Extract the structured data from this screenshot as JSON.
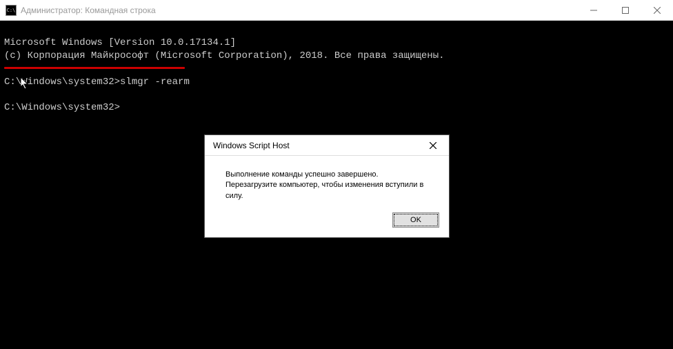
{
  "window": {
    "title": "Администратор: Командная строка",
    "icon_label": "C:\\"
  },
  "console": {
    "line1": "Microsoft Windows [Version 10.0.17134.1]",
    "line2": "(c) Корпорация Майкрософт (Microsoft Corporation), 2018. Все права защищены.",
    "blank1": "",
    "prompt1_prefix": "C:\\Windows\\system32>",
    "command1": "slmgr -rearm",
    "blank2": "",
    "prompt2_prefix": "C:\\Windows\\system32>",
    "command2": ""
  },
  "dialog": {
    "title": "Windows Script Host",
    "message_line1": "Выполнение команды успешно завершено.",
    "message_line2": "Перезагрузите компьютер, чтобы изменения вступили в силу.",
    "ok_label": "OK"
  }
}
